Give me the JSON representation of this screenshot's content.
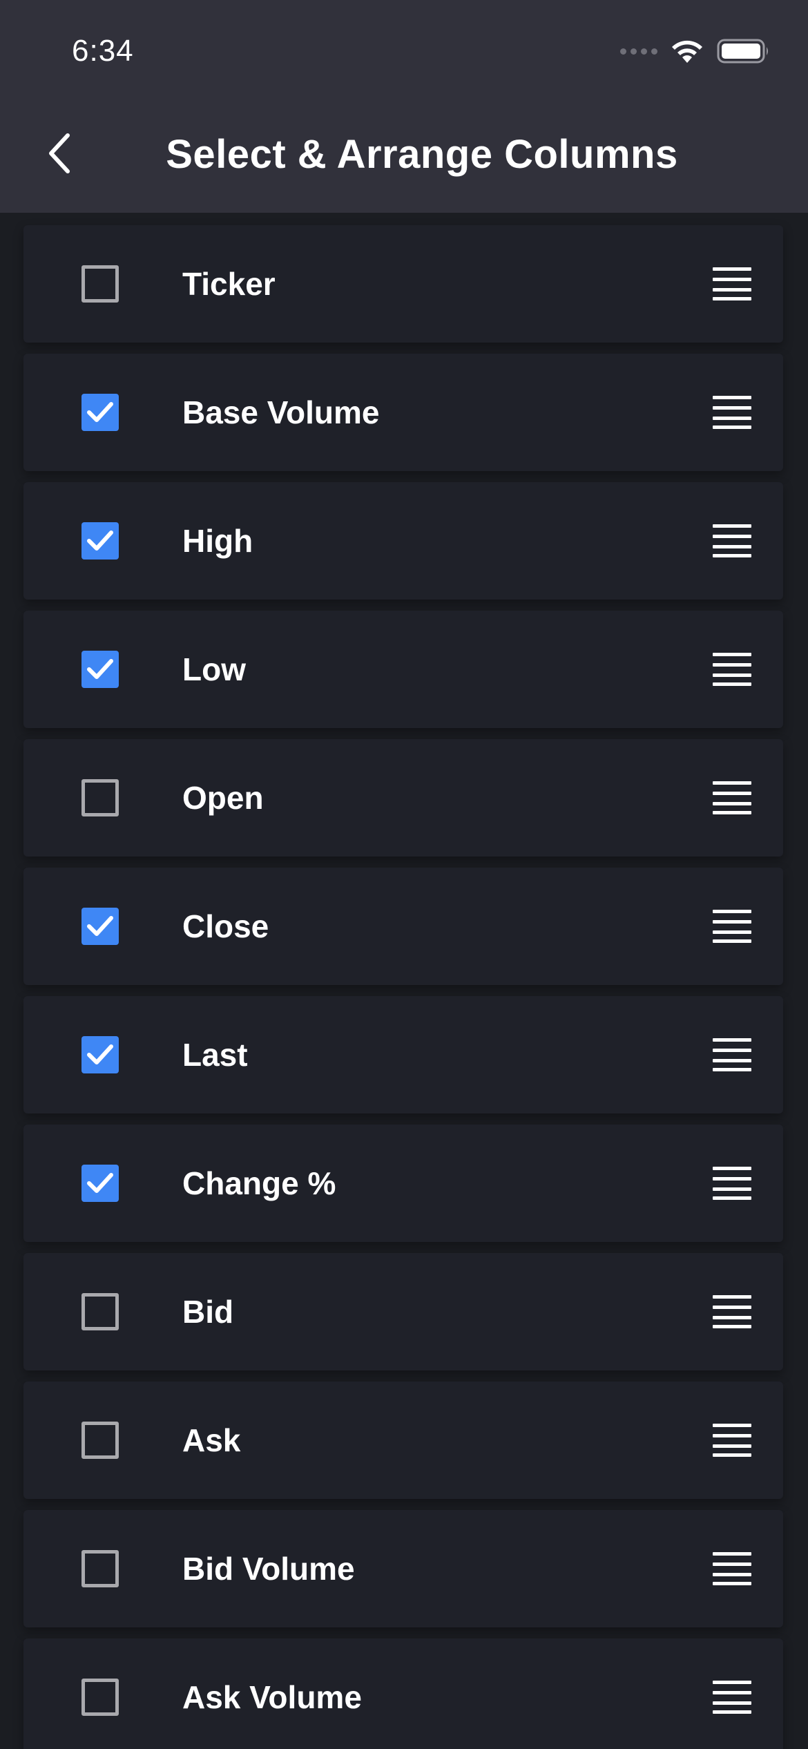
{
  "status_bar": {
    "time": "6:34",
    "icons": [
      "signal-icon",
      "wifi-icon",
      "battery-icon"
    ]
  },
  "header": {
    "back_icon": "chevron-left-icon",
    "title": "Select & Arrange Columns"
  },
  "colors": {
    "header_bg": "#31313b",
    "page_bg": "#1b1d22",
    "row_bg": "#1f2129",
    "accent_checked": "#3f87f5",
    "checkbox_border": "#a9a9ad"
  },
  "columns": [
    {
      "label": "Ticker",
      "checked": false
    },
    {
      "label": "Base Volume",
      "checked": true
    },
    {
      "label": "High",
      "checked": true
    },
    {
      "label": "Low",
      "checked": true
    },
    {
      "label": "Open",
      "checked": false
    },
    {
      "label": "Close",
      "checked": true
    },
    {
      "label": "Last",
      "checked": true
    },
    {
      "label": "Change %",
      "checked": true
    },
    {
      "label": "Bid",
      "checked": false
    },
    {
      "label": "Ask",
      "checked": false
    },
    {
      "label": "Bid Volume",
      "checked": false
    },
    {
      "label": "Ask Volume",
      "checked": false
    }
  ],
  "row_icons": {
    "checkbox": "checkbox-icon",
    "checkmark": "checkmark-icon",
    "drag": "drag-handle-icon"
  }
}
